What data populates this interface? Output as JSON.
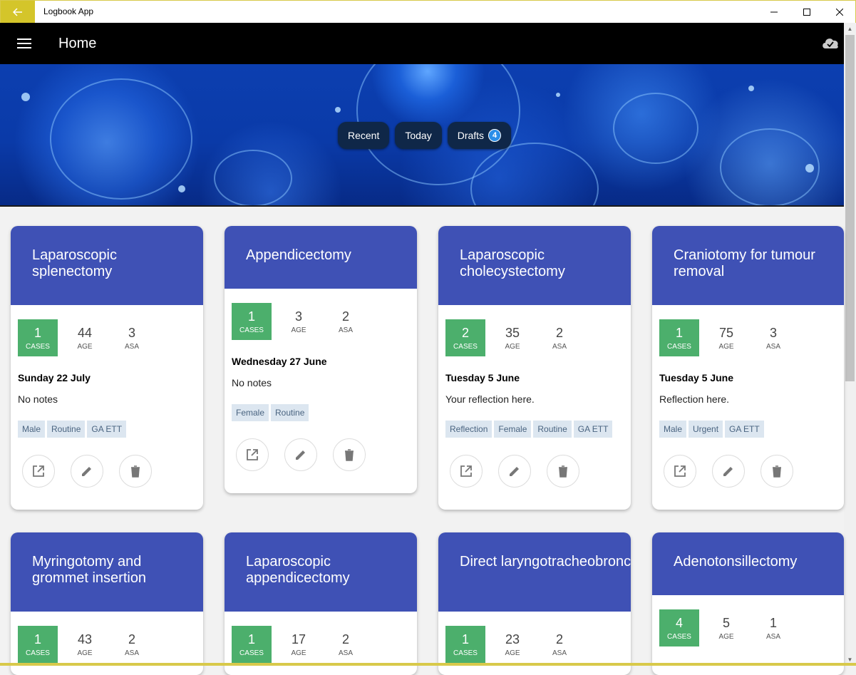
{
  "window": {
    "title": "Logbook App"
  },
  "header": {
    "title": "Home"
  },
  "filters": {
    "recent": "Recent",
    "today": "Today",
    "drafts": "Drafts",
    "drafts_count": "4"
  },
  "labels": {
    "cases": "CASES",
    "age": "AGE",
    "asa": "ASA"
  },
  "cards": [
    {
      "title": "Laparoscopic splenectomy",
      "cases": "1",
      "age": "44",
      "asa": "3",
      "date": "Sunday 22 July",
      "notes": "No notes",
      "tags": [
        "Male",
        "Routine",
        "GA ETT"
      ]
    },
    {
      "title": "Appendicectomy",
      "cases": "1",
      "age": "3",
      "asa": "2",
      "date": "Wednesday 27 June",
      "notes": "No notes",
      "tags": [
        "Female",
        "Routine"
      ]
    },
    {
      "title": "Laparoscopic cholecystectomy",
      "cases": "2",
      "age": "35",
      "asa": "2",
      "date": "Tuesday 5 June",
      "notes": "Your reflection here.",
      "tags": [
        "Reflection",
        "Female",
        "Routine",
        "GA ETT"
      ]
    },
    {
      "title": "Craniotomy for tumour removal",
      "cases": "1",
      "age": "75",
      "asa": "3",
      "date": "Tuesday 5 June",
      "notes": "Reflection here.",
      "tags": [
        "Male",
        "Urgent",
        "GA ETT"
      ]
    },
    {
      "title": "Myringotomy and grommet insertion",
      "cases": "1",
      "age": "43",
      "asa": "2"
    },
    {
      "title": "Laparoscopic appendicectomy",
      "cases": "1",
      "age": "17",
      "asa": "2"
    },
    {
      "title": "Direct laryngotracheobronchoscop",
      "cases": "1",
      "age": "23",
      "asa": "2"
    },
    {
      "title": "Adenotonsillectomy",
      "cases": "4",
      "age": "5",
      "asa": "1"
    }
  ],
  "colors": {
    "card_header": "#3f51b5",
    "cases_badge": "#4caf6c",
    "accent": "#d4c52a"
  }
}
